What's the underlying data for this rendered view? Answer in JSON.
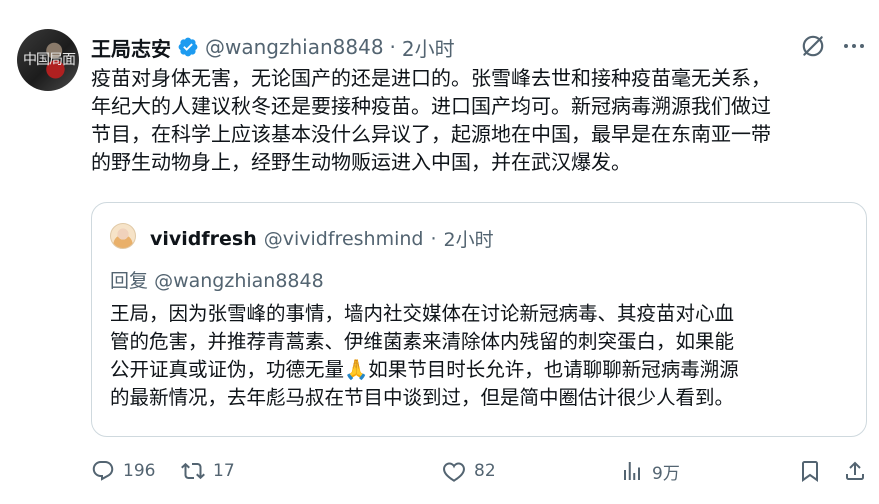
{
  "author": {
    "name": "王局志安",
    "handle": "@wangzhian8848",
    "time": "2小时",
    "verified": true,
    "avatar_text": "中国局面"
  },
  "tweet": {
    "text": "疫苗对身体无害，无论国产的还是进口的。张雪峰去世和接种疫苗毫无关系，\n年纪大的人建议秋冬还是要接种疫苗。进口国产均可。新冠病毒溯源我们做过\n节目，在科学上应该基本没什么异议了，起源地在中国，最早是在东南亚一带\n的野生动物身上，经野生动物贩运进入中国，并在武汉爆发。"
  },
  "quote": {
    "name": "vividfresh",
    "handle": "@vividfreshmind",
    "time": "2小时",
    "reply_prefix": "回复",
    "reply_to": "@wangzhian8848",
    "text": "王局，因为张雪峰的事情，墙内社交媒体在讨论新冠病毒、其疫苗对心血\n管的危害，并推荐青蒿素、伊维菌素来清除体内残留的刺突蛋白，如果能\n公开证真或证伪，功德无量🙏如果节目时长允许，也请聊聊新冠病毒溯源\n的最新情况，去年彪马叔在节目中谈到过，但是简中圈估计很少人看到。"
  },
  "actions": {
    "replies": "196",
    "retweets": "17",
    "likes": "82",
    "views": "9万"
  },
  "icons": {
    "verified": "verified-badge-icon",
    "grok": "grok-icon",
    "more": "more-icon",
    "reply": "reply-icon",
    "retweet": "retweet-icon",
    "like": "heart-icon",
    "views": "views-icon",
    "bookmark": "bookmark-icon",
    "share": "share-icon"
  },
  "colors": {
    "text": "#0f1419",
    "secondary": "#536471",
    "verified": "#1d9bf0",
    "border": "#cfd9de"
  }
}
